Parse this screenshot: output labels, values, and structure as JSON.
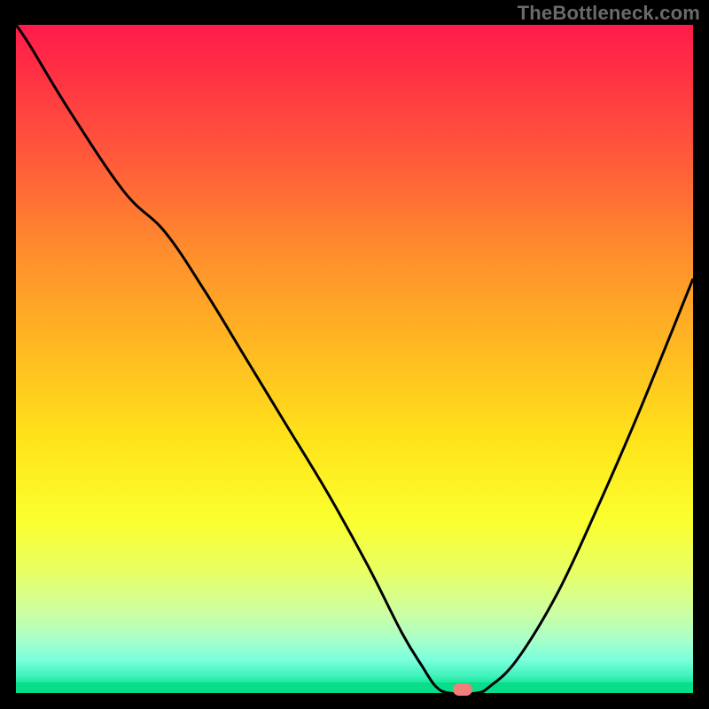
{
  "watermark": "TheBottleneck.com",
  "chart_data": {
    "type": "line",
    "title": "",
    "xlabel": "",
    "ylabel": "",
    "xlim": [
      0,
      100
    ],
    "ylim": [
      0,
      100
    ],
    "series": [
      {
        "name": "curve",
        "x": [
          0,
          2,
          8,
          16,
          22,
          28,
          34,
          40,
          46,
          52,
          57,
          60,
          62,
          64,
          68,
          70,
          74,
          80,
          86,
          92,
          100
        ],
        "y": [
          100,
          97,
          87,
          75,
          69,
          60,
          50,
          40,
          30,
          19,
          9,
          4,
          1,
          0,
          0,
          1,
          5,
          15,
          28,
          42,
          62
        ]
      }
    ],
    "marker": {
      "x": 66,
      "y": 0,
      "color": "#ef7f78"
    },
    "gradient_stops": [
      {
        "pct": 0,
        "color": "#ff1a4b"
      },
      {
        "pct": 33,
        "color": "#ff8a2e"
      },
      {
        "pct": 62,
        "color": "#ffe31a"
      },
      {
        "pct": 88,
        "color": "#ccffa2"
      },
      {
        "pct": 100,
        "color": "#08dd8a"
      }
    ]
  }
}
